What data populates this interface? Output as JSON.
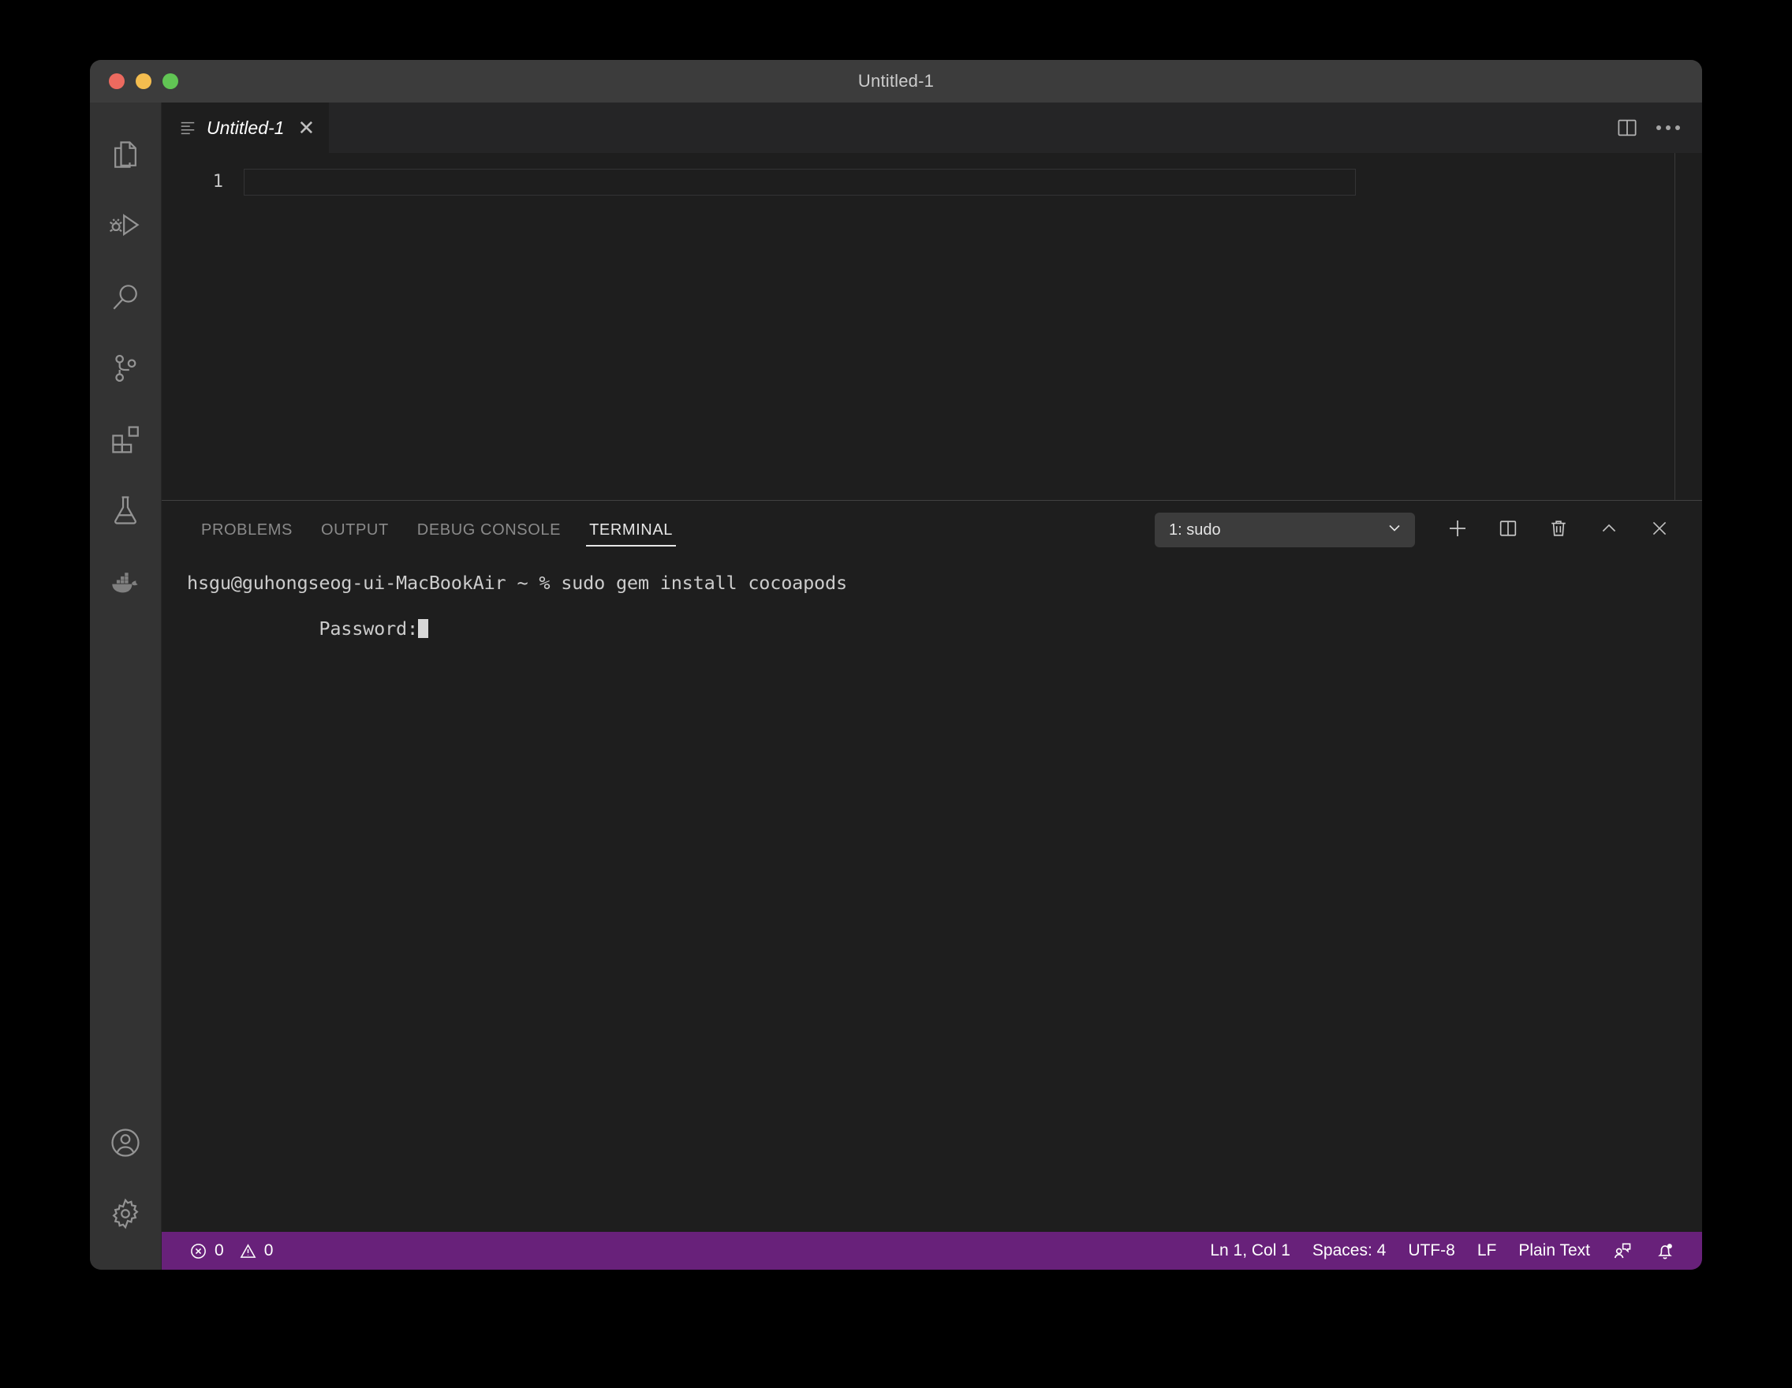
{
  "window": {
    "title": "Untitled-1",
    "traffic_lights": [
      "close-red",
      "minimize-yellow",
      "maximize-green"
    ]
  },
  "activity_bar": {
    "top_items": [
      {
        "name": "explorer",
        "icon": "files-icon",
        "label": "Explorer"
      },
      {
        "name": "run-debug",
        "icon": "run-debug-icon",
        "label": "Run and Debug"
      },
      {
        "name": "search",
        "icon": "search-icon",
        "label": "Search"
      },
      {
        "name": "source-control",
        "icon": "source-control-icon",
        "label": "Source Control"
      },
      {
        "name": "extensions",
        "icon": "extensions-icon",
        "label": "Extensions"
      },
      {
        "name": "testing",
        "icon": "beaker-icon",
        "label": "Testing"
      },
      {
        "name": "docker",
        "icon": "docker-whale-icon",
        "label": "Docker"
      }
    ],
    "bottom_items": [
      {
        "name": "accounts",
        "icon": "account-icon",
        "label": "Accounts"
      },
      {
        "name": "manage",
        "icon": "gear-icon",
        "label": "Manage"
      }
    ]
  },
  "editor": {
    "tab": {
      "label": "Untitled-1",
      "icon": "file-lines-icon",
      "close_label": "✕",
      "preview_italic": true
    },
    "actions": [
      {
        "name": "split-editor",
        "icon": "split-editor-icon"
      },
      {
        "name": "more-actions",
        "icon": "ellipsis-icon"
      }
    ],
    "line_numbers": [
      "1"
    ],
    "content_lines": [
      ""
    ]
  },
  "panel": {
    "tabs": [
      {
        "label": "PROBLEMS",
        "active": false
      },
      {
        "label": "OUTPUT",
        "active": false
      },
      {
        "label": "DEBUG CONSOLE",
        "active": false
      },
      {
        "label": "TERMINAL",
        "active": true
      }
    ],
    "terminal_selector": {
      "value": "1: sudo",
      "chevron": "chevron-down-icon"
    },
    "actions": [
      {
        "name": "new-terminal",
        "icon": "plus-icon"
      },
      {
        "name": "split-terminal",
        "icon": "split-icon"
      },
      {
        "name": "kill-terminal",
        "icon": "trash-icon"
      },
      {
        "name": "maximize-panel",
        "icon": "chevron-up-icon"
      },
      {
        "name": "close-panel",
        "icon": "close-icon"
      }
    ]
  },
  "terminal": {
    "lines": [
      "hsgu@guhongseog-ui-MacBookAir ~ % sudo gem install cocoapods",
      "Password:"
    ],
    "prompt_line_index": 1,
    "cursor_visible": true
  },
  "status_bar": {
    "errors_count": "0",
    "warnings_count": "0",
    "error_icon": "error-circle-icon",
    "warning_icon": "warning-triangle-icon",
    "right_items": [
      {
        "name": "cursor-position",
        "label": "Ln 1, Col 1"
      },
      {
        "name": "indentation",
        "label": "Spaces: 4"
      },
      {
        "name": "encoding",
        "label": "UTF-8"
      },
      {
        "name": "eol",
        "label": "LF"
      },
      {
        "name": "language-mode",
        "label": "Plain Text"
      }
    ],
    "right_icons": [
      {
        "name": "live-share",
        "icon": "live-share-icon"
      },
      {
        "name": "notifications",
        "icon": "bell-dot-icon"
      }
    ],
    "background_color": "#68217a"
  },
  "colors": {
    "titlebar": "#3c3c3c",
    "activitybar": "#333333",
    "editor_background": "#1e1e1e",
    "tabs_background": "#252526",
    "status_purple": "#68217a",
    "terminal_text": "#cccccc"
  }
}
